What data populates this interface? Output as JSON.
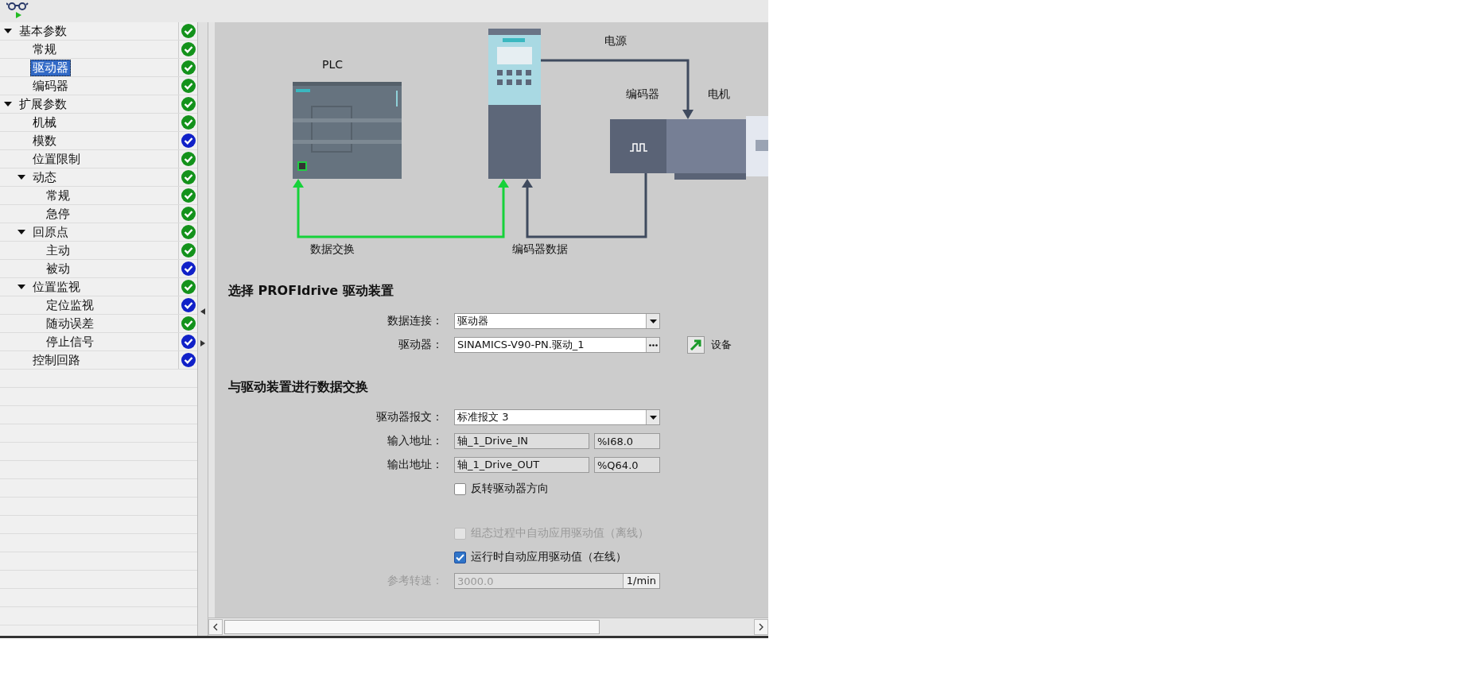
{
  "tree": [
    {
      "label": "基本参数",
      "selected": false,
      "expanded": true,
      "color": "#13921b",
      "children": [
        {
          "label": "常规",
          "selected": false,
          "color": "#13921b"
        },
        {
          "label": "驱动器",
          "selected": true,
          "color": "#13921b"
        },
        {
          "label": "编码器",
          "selected": false,
          "color": "#13921b"
        }
      ]
    },
    {
      "label": "扩展参数",
      "selected": false,
      "expanded": true,
      "color": "#13921b",
      "children": [
        {
          "label": "机械",
          "selected": false,
          "color": "#13921b"
        },
        {
          "label": "模数",
          "selected": false,
          "color": "#1020c8"
        },
        {
          "label": "位置限制",
          "selected": false,
          "color": "#13921b"
        },
        {
          "label": "动态",
          "selected": false,
          "expanded": true,
          "color": "#13921b",
          "children": [
            {
              "label": "常规",
              "selected": false,
              "color": "#13921b"
            },
            {
              "label": "急停",
              "selected": false,
              "color": "#13921b"
            }
          ]
        },
        {
          "label": "回原点",
          "selected": false,
          "expanded": true,
          "color": "#13921b",
          "children": [
            {
              "label": "主动",
              "selected": false,
              "color": "#13921b"
            },
            {
              "label": "被动",
              "selected": false,
              "color": "#1020c8"
            }
          ]
        },
        {
          "label": "位置监视",
          "selected": false,
          "expanded": true,
          "color": "#13921b",
          "children": [
            {
              "label": "定位监视",
              "selected": false,
              "color": "#1020c8"
            },
            {
              "label": "随动误差",
              "selected": false,
              "color": "#13921b"
            },
            {
              "label": "停止信号",
              "selected": false,
              "color": "#1020c8"
            }
          ]
        },
        {
          "label": "控制回路",
          "selected": false,
          "color": "#1020c8"
        }
      ]
    }
  ],
  "diagram": {
    "plc": "PLC",
    "power": "电源",
    "encoder": "编码器",
    "motor": "电机",
    "data_exchange": "数据交换",
    "encoder_data": "编码器数据"
  },
  "sections": [
    {
      "title": "选择 PROFIdrive 驱动装置",
      "rows": [
        {
          "kind": "dropdown",
          "label": "数据连接：",
          "value": "驱动器"
        },
        {
          "kind": "browse",
          "label": "驱动器：",
          "value": "SINAMICS-V90-PN.驱动_1",
          "link": "设备"
        }
      ]
    },
    {
      "title": "与驱动装置进行数据交换",
      "rows": [
        {
          "kind": "dropdown",
          "label": "驱动器报文：",
          "value": "标准报文 3"
        },
        {
          "kind": "address",
          "label": "输入地址：",
          "symbol": "轴_1_Drive_IN",
          "address": "%I68.0"
        },
        {
          "kind": "address",
          "label": "输出地址：",
          "symbol": "轴_1_Drive_OUT",
          "address": "%Q64.0"
        },
        {
          "kind": "checkbox",
          "label": "反转驱动器方向",
          "checked": false,
          "disabled": false
        },
        {
          "kind": "checkbox",
          "label": "组态过程中自动应用驱动值（离线）",
          "checked": false,
          "disabled": true
        },
        {
          "kind": "checkbox",
          "label": "运行时自动应用驱动值（在线）",
          "checked": true,
          "disabled": false
        },
        {
          "kind": "unit_field",
          "label": "参考转速：",
          "value": "3000.0",
          "unit": "1/min",
          "disabled": true
        }
      ]
    }
  ]
}
